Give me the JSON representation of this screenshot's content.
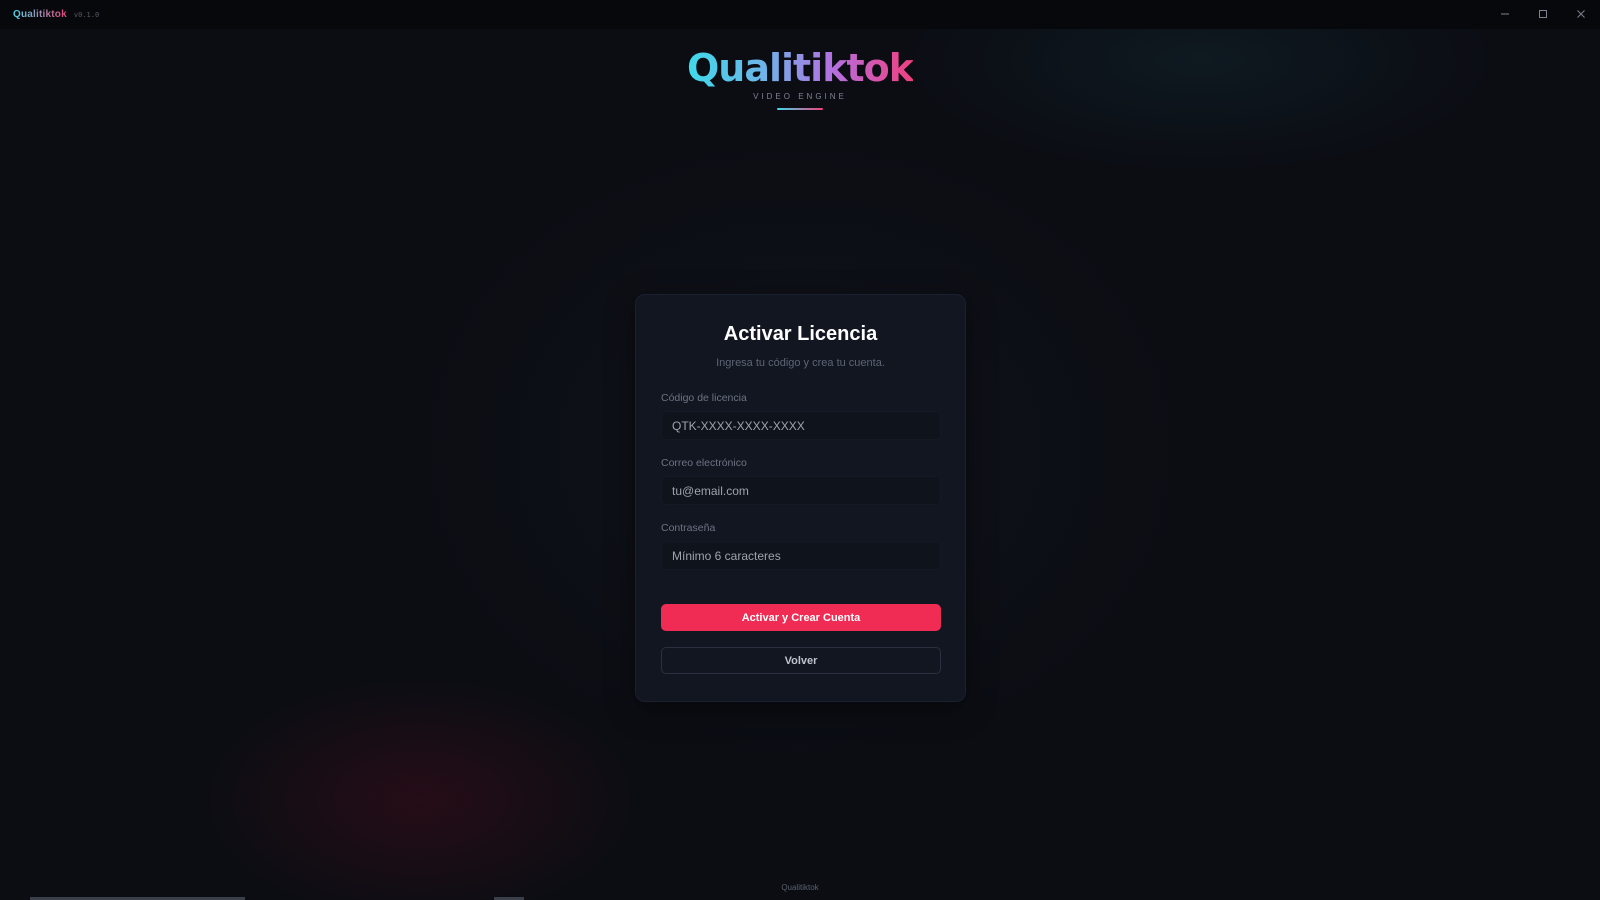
{
  "titlebar": {
    "app_name": "Qualitiktok",
    "version": "v0.1.0",
    "controls": {
      "minimize_icon": "minimize-icon",
      "maximize_icon": "maximize-icon",
      "close_icon": "close-icon"
    }
  },
  "brand": {
    "name": "Qualitiktok",
    "tagline": "VIDEO ENGINE"
  },
  "card": {
    "title": "Activar Licencia",
    "subtitle": "Ingresa tu código y crea tu cuenta.",
    "fields": {
      "license": {
        "label": "Código de licencia",
        "placeholder": "QTK-XXXX-XXXX-XXXX",
        "value": ""
      },
      "email": {
        "label": "Correo electrónico",
        "placeholder": "tu@email.com",
        "value": ""
      },
      "password": {
        "label": "Contraseña",
        "placeholder": "Mínimo 6 caracteres",
        "value": ""
      }
    },
    "primary_button": "Activar y Crear Cuenta",
    "secondary_button": "Volver"
  },
  "footer": {
    "text": "Qualitiktok"
  },
  "colors": {
    "accent": "#f02c54",
    "brand_gradient_start": "#3fd9ea",
    "brand_gradient_end": "#f0407e",
    "card_background": "#121621"
  }
}
